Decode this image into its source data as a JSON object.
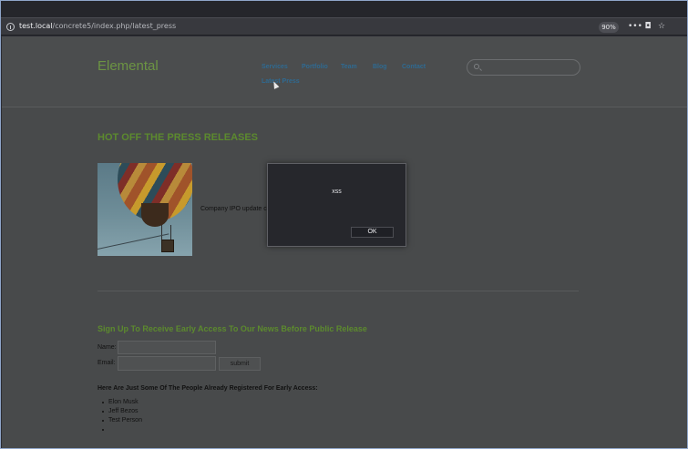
{
  "browser": {
    "url_host": "test.local",
    "url_path": "/concrete5/index.php/latest_press",
    "zoom": "90%",
    "more_icon": "ellipsis-icon",
    "pocket_icon": "pocket-icon",
    "bookmark_icon": "star-icon",
    "more_label": "•••",
    "pocket_label": "◘",
    "bookmark_label": "☆"
  },
  "site": {
    "logo": "Elemental",
    "nav": [
      "Services",
      "Portfolio",
      "Team",
      "Blog",
      "Contact",
      "Latest Press"
    ],
    "search_placeholder": ""
  },
  "main": {
    "heading": "HOT OFF THE PRESS RELEASES",
    "press_item_text": "Company IPO update co",
    "signup_heading": "Sign Up To Receive Early Access To Our News Before Public Release",
    "name_label": "Name:",
    "email_label": "Email:",
    "submit_label": "submit",
    "registered_heading": "Here Are Just Some Of The People Already Registered For Early Access:",
    "registered": [
      "Elon Musk",
      "Jeff Bezos",
      "Test Person",
      ""
    ]
  },
  "dialog": {
    "message": "xss",
    "ok_label": "OK"
  }
}
